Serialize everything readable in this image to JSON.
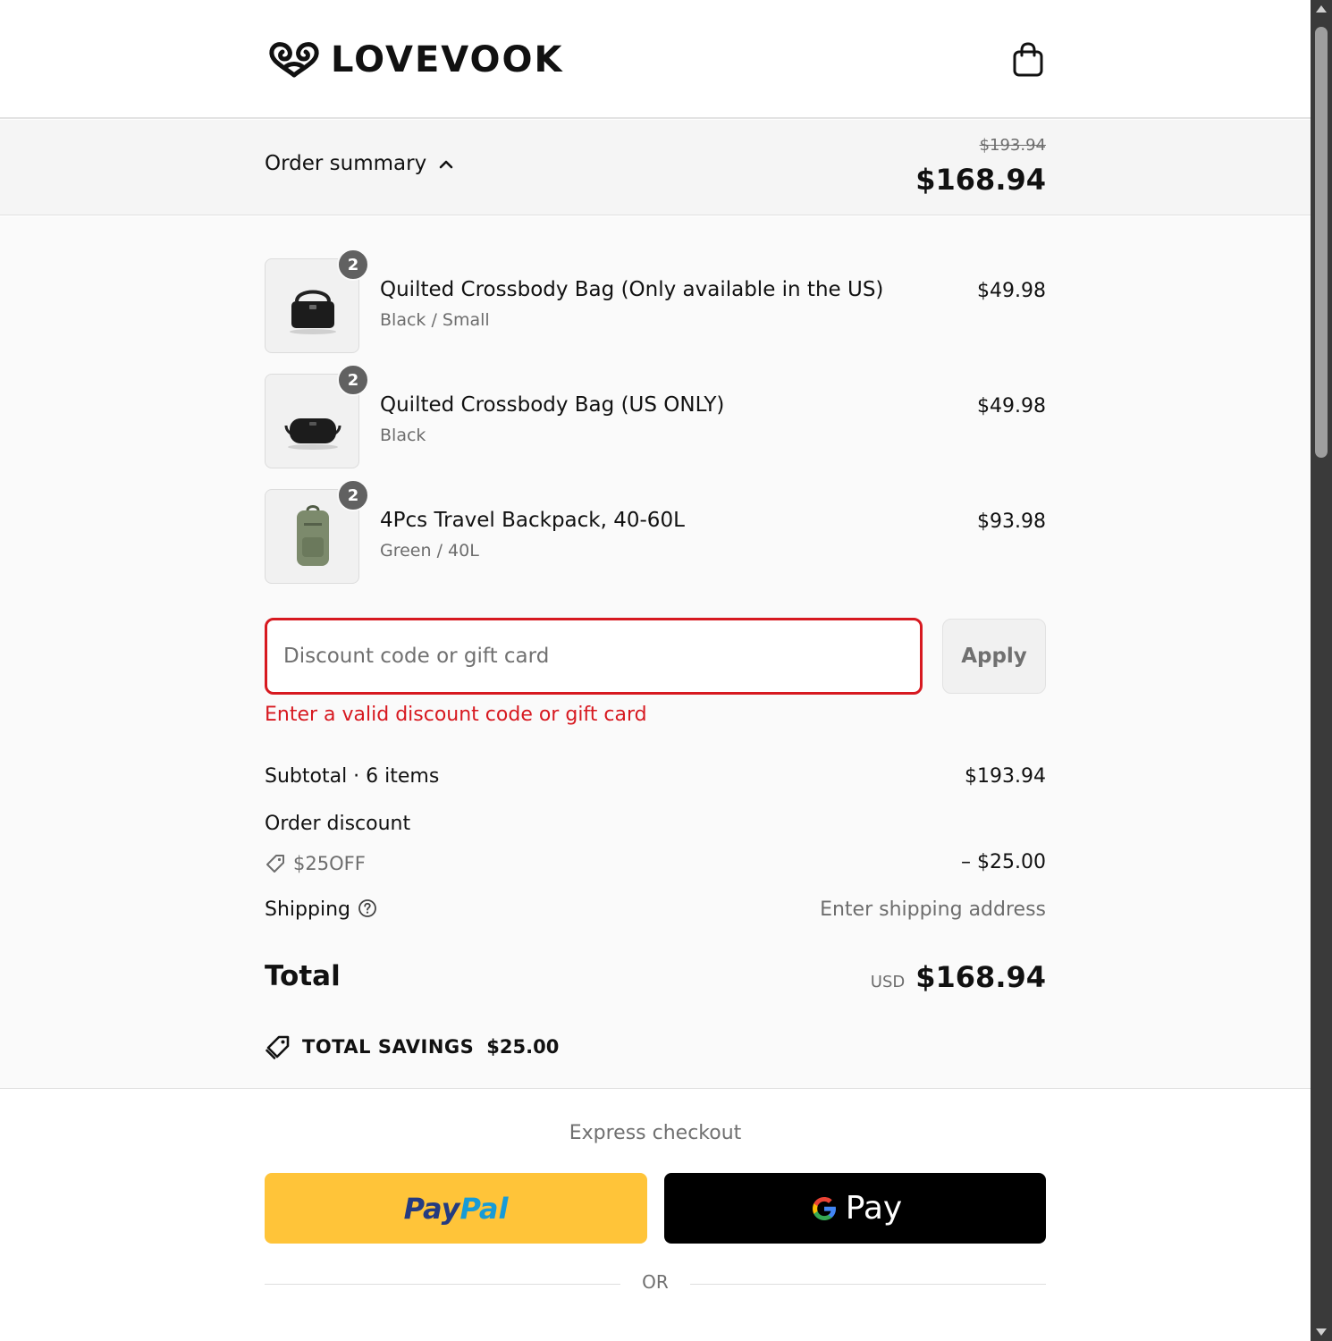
{
  "header": {
    "brand": "LOVEVOOK",
    "cart_icon": "shopping-bag-icon"
  },
  "summary": {
    "toggle_label": "Order summary",
    "toggle_icon": "chevron-up-icon",
    "original_total": "$193.94",
    "total": "$168.94"
  },
  "items": [
    {
      "qty": "2",
      "name": "Quilted Crossbody Bag (Only available in the US)",
      "variant": "Black / Small",
      "price": "$49.98",
      "image": "black-crossbody-bag-small"
    },
    {
      "qty": "2",
      "name": "Quilted Crossbody Bag (US ONLY)",
      "variant": "Black",
      "price": "$49.98",
      "image": "black-crossbody-bag"
    },
    {
      "qty": "2",
      "name": "4Pcs Travel Backpack, 40-60L",
      "variant": "Green / 40L",
      "price": "$93.98",
      "image": "green-backpack"
    }
  ],
  "discount": {
    "placeholder": "Discount code or gift card",
    "value": "",
    "apply_label": "Apply",
    "error": "Enter a valid discount code or gift card"
  },
  "totals": {
    "subtotal_label": "Subtotal · 6 items",
    "subtotal_value": "$193.94",
    "order_discount_label": "Order discount",
    "discount_code": "$25OFF",
    "discount_value": "– $25.00",
    "shipping_label": "Shipping",
    "shipping_value": "Enter shipping address",
    "total_label": "Total",
    "currency": "USD",
    "total_value": "$168.94",
    "savings_label": "TOTAL SAVINGS",
    "savings_value": "$25.00"
  },
  "express": {
    "title": "Express checkout",
    "paypal_a": "Pay",
    "paypal_b": "Pal",
    "gpay_label": "Pay",
    "or_label": "OR"
  },
  "colors": {
    "error": "#d71920",
    "paypal_bg": "#ffc439",
    "gpay_bg": "#000000"
  }
}
